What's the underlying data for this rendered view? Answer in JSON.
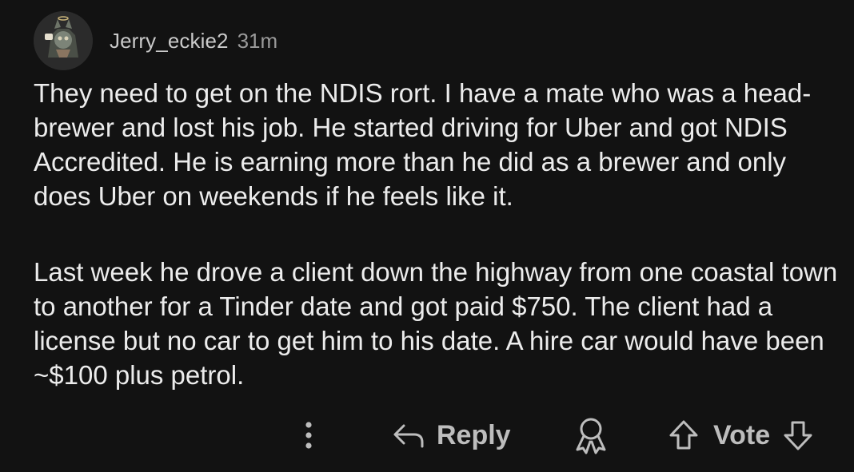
{
  "comment": {
    "author": "Jerry_eckie2",
    "time_ago": "31m",
    "paragraphs": [
      "They need to get on the NDIS rort. I have a mate who was a head-brewer and lost his job. He started driving for Uber and got NDIS Accredited. He is earning more than he did as a brewer and only does Uber on weekends if he feels like it.",
      "Last week he drove a client down the highway from one coastal town to another for a Tinder date and got paid $750. The client had a license but no car to get him to his date. A hire car would have been ~$100 plus petrol."
    ]
  },
  "actions": {
    "more_icon": "vertical-dots-icon",
    "reply_icon": "reply-arrow-icon",
    "reply_label": "Reply",
    "award_icon": "award-ribbon-icon",
    "upvote_icon": "upvote-arrow-icon",
    "vote_label": "Vote",
    "downvote_icon": "downvote-arrow-icon"
  },
  "colors": {
    "background": "#121212",
    "text": "#ececec",
    "muted": "#9a9a9a",
    "action": "#bdbdbd"
  }
}
